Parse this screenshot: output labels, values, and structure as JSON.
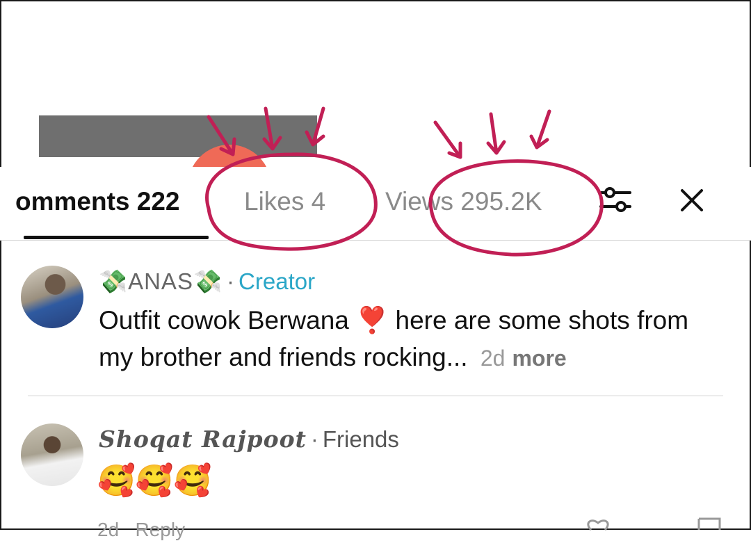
{
  "tabs": {
    "comments": "omments 222",
    "likes": "Likes 4",
    "views": "Views 295.2K"
  },
  "comments": [
    {
      "user": "💸ANAS💸",
      "badge": "Creator",
      "text": "Outfit cowok Berwana ❣️ here are some shots from my brother and friends rocking...",
      "time": "2d",
      "more": "more"
    },
    {
      "user": "Shoqat Rajpoot",
      "relation": "Friends",
      "text": "🥰🥰🥰",
      "footer_time": "2d",
      "reply": "Reply"
    }
  ],
  "icons": {
    "filter": "filter-sliders-icon",
    "close": "close-icon",
    "like": "heart-icon",
    "dislike": "thumbs-down-icon"
  },
  "colors": {
    "annotation": "#c11f55",
    "creator_badge": "#2aa6c7",
    "header_gray": "#6f6f6f",
    "header_orange": "#ef6a57"
  }
}
